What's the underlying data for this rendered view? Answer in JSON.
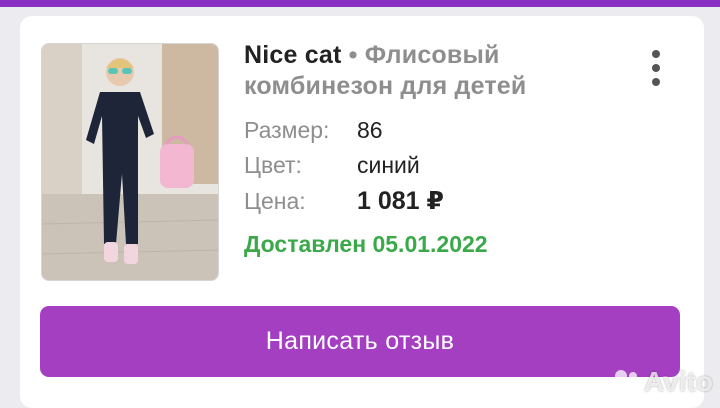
{
  "product": {
    "brand": "Nice cat",
    "separator": "•",
    "name": "Флисовый комбинезон для детей",
    "image_icon": "product-photo"
  },
  "attributes": [
    {
      "label": "Размер:",
      "value": "86"
    },
    {
      "label": "Цвет:",
      "value": "синий"
    },
    {
      "label": "Цена:",
      "value": "1 081 ₽"
    }
  ],
  "status": {
    "text": "Доставлен 05.01.2022",
    "color": "#3ba84a"
  },
  "actions": {
    "review_label": "Написать отзыв",
    "menu_icon": "more-vertical-icon"
  },
  "watermark": {
    "text": "Avito"
  },
  "colors": {
    "accent": "#a43fc2",
    "top_bar": "#8a2fc4",
    "success": "#3ba84a"
  }
}
